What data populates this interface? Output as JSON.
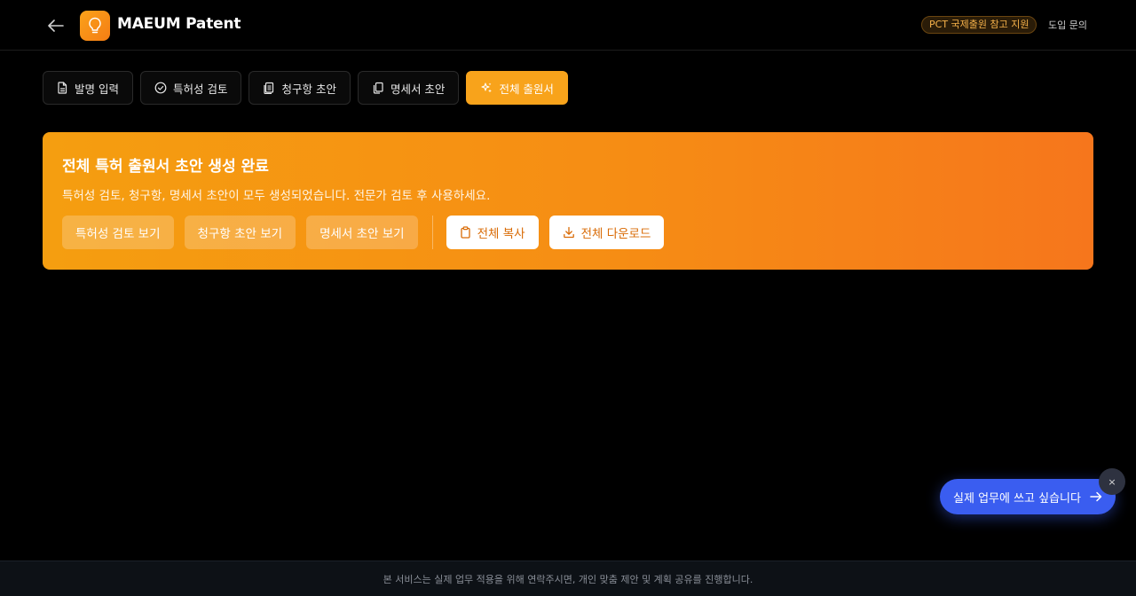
{
  "header": {
    "brand": "MAEUM Patent",
    "badge": "PCT 국제출원 참고 지원",
    "inquiry": "도입 문의"
  },
  "tabs": [
    {
      "label": "발명 입력",
      "icon": "document-icon",
      "active": false
    },
    {
      "label": "특허성 검토",
      "icon": "check-circle-icon",
      "active": false
    },
    {
      "label": "청구항 초안",
      "icon": "clipboard-list-icon",
      "active": false
    },
    {
      "label": "명세서 초안",
      "icon": "copy-documents-icon",
      "active": false
    },
    {
      "label": "전체 출원서",
      "icon": "sparkles-icon",
      "active": true
    }
  ],
  "result": {
    "title": "전체 특허 출원서 초안 생성 완료",
    "description": "특허성 검토, 청구항, 명세서 초안이 모두 생성되었습니다. 전문가 검토 후 사용하세요.",
    "view_buttons": [
      "특허성 검토 보기",
      "청구항 초안 보기",
      "명세서 초안 보기"
    ],
    "copy_label": "전체 복사",
    "download_label": "전체 다운로드"
  },
  "cta": {
    "label": "실제 업무에 쓰고 싶습니다",
    "close": "×"
  },
  "footer": {
    "text": "본 서비스는 실제 업무 적용을 위해 연락주시면, 개인 맞춤 제안 및 계획 공유를 진행합니다."
  },
  "colors": {
    "accent": "#f8a31b",
    "card_gradient_start": "#f59e10",
    "card_gradient_end": "#f6761c",
    "cta_blue": "#3a5df0",
    "background": "#000000"
  }
}
